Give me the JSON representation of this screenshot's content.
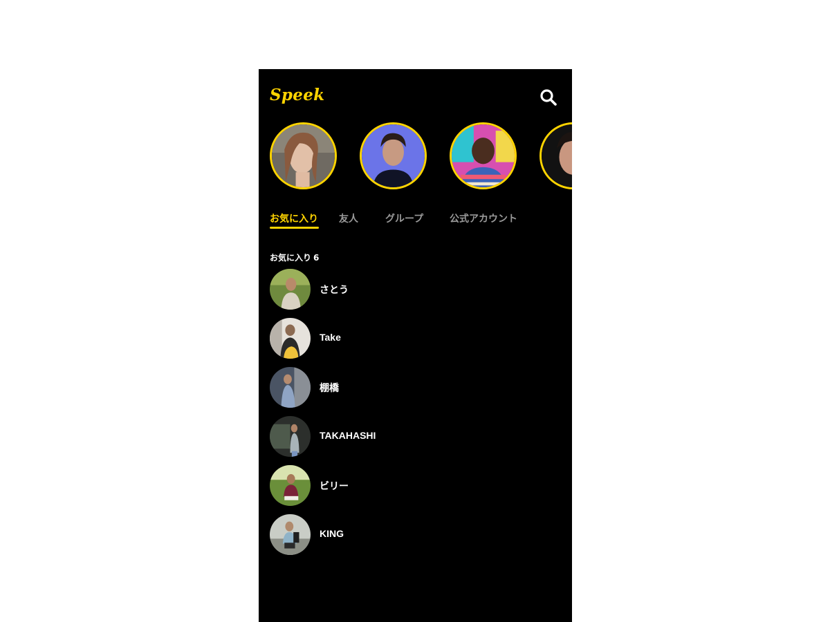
{
  "app": {
    "logo": "Speek",
    "accent_color": "#ffd400",
    "search_icon": "search-icon"
  },
  "stories": [
    {
      "icon": "avatar-photo"
    },
    {
      "icon": "avatar-photo"
    },
    {
      "icon": "avatar-photo"
    },
    {
      "icon": "avatar-photo"
    }
  ],
  "tabs": [
    {
      "label": "お気に入り",
      "active": true
    },
    {
      "label": "友人",
      "active": false
    },
    {
      "label": "グループ",
      "active": false
    },
    {
      "label": "公式アカウント",
      "active": false
    }
  ],
  "favorites": {
    "title": "お気に入り",
    "count": "6",
    "items": [
      {
        "name": "さとう"
      },
      {
        "name": "Take"
      },
      {
        "name": "棚橋"
      },
      {
        "name": "TAKAHASHI"
      },
      {
        "name": "ビリー"
      },
      {
        "name": "KING"
      }
    ]
  }
}
